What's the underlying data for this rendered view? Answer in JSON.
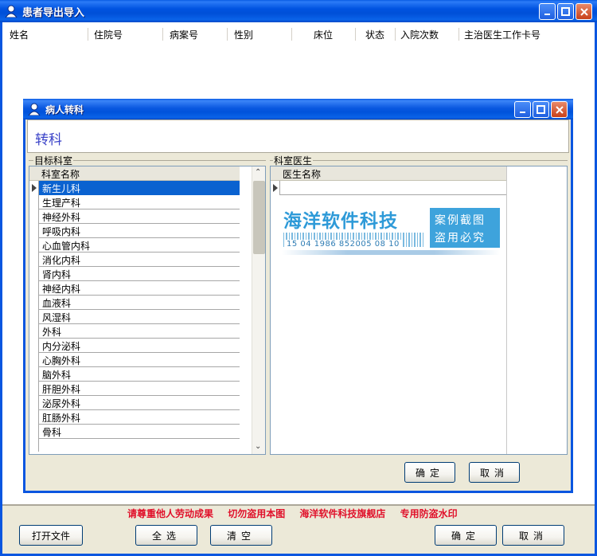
{
  "window": {
    "title": "患者导出导入"
  },
  "grid": {
    "columns": [
      "姓名",
      "住院号",
      "病案号",
      "性别",
      "床位",
      "状态",
      "入院次数",
      "主治医生工作卡号"
    ]
  },
  "dialog": {
    "title": "病人转科",
    "heading": "转科",
    "target_group": "目标科室",
    "doctor_group": "科室医生",
    "dept_column": "科室名称",
    "doctor_column": "医生名称",
    "departments": [
      "新生儿科",
      "生理产科",
      "神经外科",
      "呼吸内科",
      "心血管内科",
      "消化内科",
      "肾内科",
      "神经内科",
      "血液科",
      "风湿科",
      "外科",
      "内分泌科",
      "心胸外科",
      "脑外科",
      "肝胆外科",
      "泌尿外科",
      "肛肠外科",
      "骨科"
    ],
    "selected_department": "新生儿科",
    "ok_label": "确定",
    "cancel_label": "取消"
  },
  "watermark": {
    "main": "海洋软件科技",
    "box_line1": "案例截图",
    "box_line2": "盗用必究",
    "number": "15 04 1986 852005 08 10"
  },
  "notice": [
    "请尊重他人劳动成果",
    "切勿盗用本图",
    "海洋软件科技旗舰店",
    "专用防盗水印"
  ],
  "footer": {
    "open_file": "打开文件",
    "select_all": "全选",
    "clear": "清空",
    "ok": "确定",
    "cancel": "取消"
  }
}
